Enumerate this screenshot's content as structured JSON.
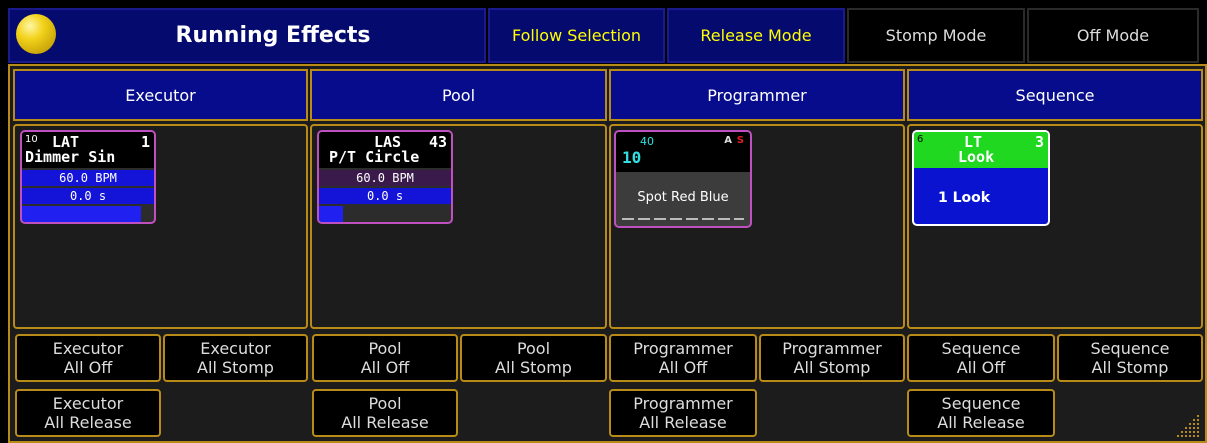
{
  "window": {
    "title": "Running Effects"
  },
  "modes": {
    "follow_selection": "Follow Selection",
    "release_mode": "Release Mode",
    "stomp_mode": "Stomp Mode",
    "off_mode": "Off Mode",
    "active_color": "#ffff00"
  },
  "columns": {
    "executor": {
      "title": "Executor",
      "tile": {
        "id": "10",
        "type": "LAT",
        "num": "1",
        "name": "Dimmer Sin",
        "bpm": "60.0 BPM",
        "phase": "0.0 s",
        "progress": 0.9
      },
      "buttons": {
        "off_1": "Executor",
        "off_2": "All Off",
        "stomp_1": "Executor",
        "stomp_2": "All Stomp",
        "release_1": "Executor",
        "release_2": "All Release"
      }
    },
    "pool": {
      "title": "Pool",
      "tile": {
        "type": "LAS",
        "num": "43",
        "name": "P/T Circle",
        "bpm": "60.0 BPM",
        "phase": "0.0 s",
        "progress": 0.18
      },
      "buttons": {
        "off_1": "Pool",
        "off_2": "All Off",
        "stomp_1": "Pool",
        "stomp_2": "All Stomp",
        "release_1": "Pool",
        "release_2": "All Release"
      }
    },
    "programmer": {
      "title": "Programmer",
      "tile": {
        "small": "40",
        "big": "10",
        "flag_a": "A",
        "flag_s": "S",
        "name": "Spot Red Blue"
      },
      "buttons": {
        "off_1": "Programmer",
        "off_2": "All Off",
        "stomp_1": "Programmer",
        "stomp_2": "All Stomp",
        "release_1": "Programmer",
        "release_2": "All Release"
      }
    },
    "sequence": {
      "title": "Sequence",
      "tile": {
        "id": "6",
        "type": "LT",
        "num": "3",
        "name": "Look",
        "cue": "1 Look"
      },
      "buttons": {
        "off_1": "Sequence",
        "off_2": "All Off",
        "stomp_1": "Sequence",
        "stomp_2": "All Stomp",
        "release_1": "Sequence",
        "release_2": "All Release"
      }
    }
  },
  "icons": {
    "status": "status-ball-icon",
    "grip": "resize-grip-icon"
  }
}
